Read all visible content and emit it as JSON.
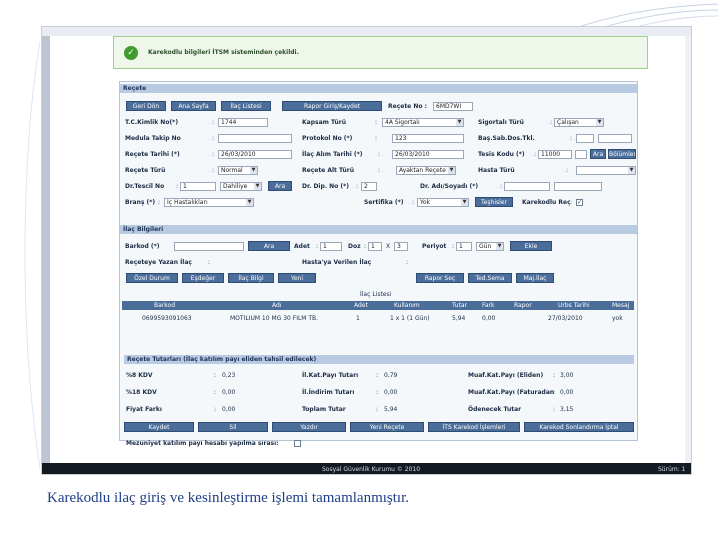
{
  "alert": {
    "message": "Karekodlu bilgileri İTSM sisteminden çekildi."
  },
  "recete": {
    "title": "Reçete",
    "nav_buttons": [
      "Geri Dön",
      "Ana Sayfa",
      "İlaç Listesi",
      "Rapor Giriş/Kaydet"
    ],
    "recete_no_label": "Reçete No :",
    "recete_no_value": "6MD7WI",
    "fields": {
      "tc_kimlik": {
        "label": "T.C.Kimlik No(*)",
        "value": "1744"
      },
      "kapsam_turu": {
        "label": "Kapsam Türü",
        "value": "4A Sigortalı"
      },
      "sigortali_turu": {
        "label": "Sigortalı Türü",
        "value": "Çalışan"
      },
      "medula_takip": {
        "label": "Medula Takip No",
        "value": ""
      },
      "protokol_no": {
        "label": "Protokol No (*)",
        "value": "123"
      },
      "bas_sab_dos": {
        "label": "Baş.Sab.Dos.Tkl.",
        "value": ""
      },
      "recete_tarihi": {
        "label": "Reçete Tarihi (*)",
        "value": "26/03/2010"
      },
      "ilac_alim_tarihi": {
        "label": "İlaç Alım Tarihi (*)",
        "value": "26/03/2010"
      },
      "tesis_kodu": {
        "label": "Tesis Kodu (*)",
        "value": "11000"
      },
      "recete_turu": {
        "label": "Reçete Türü",
        "value": "Normal"
      },
      "recete_alt_turu": {
        "label": "Reçete Alt Türü",
        "value": "Ayaktan Reçete"
      },
      "hasta_turu": {
        "label": "Hasta Türü",
        "value": ""
      },
      "dr_tescil": {
        "label": "Dr.Tescil No",
        "value": "1"
      },
      "dr_brans": {
        "value": "Dahiliye"
      },
      "dr_dip": {
        "label": "Dr. Dip. No (*)",
        "value": "2"
      },
      "dr_adi": {
        "label": "Dr. Adı/Soyadı (*)",
        "value": ""
      },
      "brans": {
        "label": "Branş (*)",
        "value": "İç Hastalıkları"
      },
      "sertifika": {
        "label": "Sertifika (*)",
        "value": "Yok"
      },
      "karekodlu_recete": {
        "label": "Karekodlu Reçete",
        "checked": "✓"
      }
    },
    "side_buttons": {
      "ara_tesis": "Ara",
      "bolumler": "Bölümler",
      "ara_dr": "Ara",
      "teshisler": "Teşhisler"
    }
  },
  "ilac": {
    "title": "İlaç Bilgileri",
    "barkod_label": "Barkod (*)",
    "ara_button": "Ara",
    "adet_label": "Adet",
    "adet_value": "1",
    "doz_label": "Doz",
    "doz_value": "1",
    "doz_sep": "X",
    "doz_value2": "3",
    "periyot_label": "Periyot",
    "periyot_value": "1",
    "periyot_unit": "Gün",
    "ekle_button": "Ekle",
    "receteye_label": "Reçeteye Yazan İlaç",
    "hastaya_label": "Hasta'ya Verilen İlaç",
    "action_buttons": [
      "Özel Durum",
      "Eşdeğer",
      "İlaç Bilgi",
      "Yeni",
      "Rapor Seç",
      "Ted.Sema",
      "Maj.İlaç"
    ],
    "list_title": "İlaç Listesi",
    "columns": [
      "Barkod",
      "Adı",
      "Adet",
      "Kullanım",
      "Tutar",
      "Fark",
      "Rapor",
      "Urbs Tarihi",
      "Mesaj"
    ],
    "rows": [
      [
        "0699593091063",
        "MOTILIUM 10 MG 30 FILM TB.",
        "1",
        "1 x 1 (1 Gün)",
        "5,94",
        "0,00",
        "",
        "27/03/2010",
        "yok"
      ]
    ]
  },
  "tutarlar": {
    "title": "Reçete Tutarları (İlaç katılım payı eliden tahsil edilecek)",
    "items": [
      {
        "label": "%8 KDV",
        "value": "0,23"
      },
      {
        "label": "İl.Kat.Payı Tutarı",
        "value": "0,79"
      },
      {
        "label": "Muaf.Kat.Payı (Eliden)",
        "value": "3,00"
      },
      {
        "label": "%18 KDV",
        "value": "0,00"
      },
      {
        "label": "İl.İndirim Tutarı",
        "value": "0,00"
      },
      {
        "label": "Muaf.Kat.Payı (Faturadan)",
        "value": "0,00"
      },
      {
        "label": "Fiyat Farkı",
        "value": "0,00"
      },
      {
        "label": "Toplam Tutar",
        "value": "5,94"
      },
      {
        "label": "Ödenecek Tutar",
        "value": "3,15"
      }
    ],
    "buttons": [
      "Kaydet",
      "Sil",
      "Yazdır",
      "Yeni Reçete",
      "İTS Karekod İşlemleri",
      "Karekod Sonlandırma İptal"
    ],
    "bottom_check_label": "Mezuniyet katılım payı hesabı yapılma sırası:"
  },
  "footer": {
    "left": "Sosyal Güvenlik Kurumu © 2010",
    "right": "Sürüm: 1"
  },
  "caption": "Karekodlu ilaç giriş ve kesinleştirme işlemi tamamlanmıştır."
}
